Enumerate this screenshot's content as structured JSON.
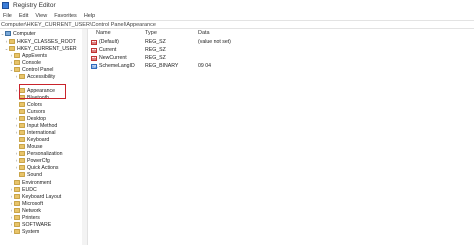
{
  "window": {
    "title": "Registry Editor"
  },
  "menu": [
    "File",
    "Edit",
    "View",
    "Favorites",
    "Help"
  ],
  "address": "Computer\\HKEY_CURRENT_USER\\Control Panel\\Appearance",
  "tree": [
    {
      "label": "Computer",
      "chevron": "⌄",
      "icon": "computer"
    },
    {
      "label": "HKEY_CLASSES_ROOT",
      "chevron": "›",
      "icon": "folder"
    },
    {
      "label": "HKEY_CURRENT_USER",
      "chevron": "⌄",
      "icon": "folder"
    },
    {
      "label": "AppEvents",
      "chevron": "›",
      "icon": "folder"
    },
    {
      "label": "Console",
      "chevron": "›",
      "icon": "folder"
    },
    {
      "label": "Control Panel",
      "chevron": "⌄",
      "icon": "folder"
    },
    {
      "label": "Accessibility",
      "chevron": "›",
      "icon": "folder"
    },
    {
      "label": "Appearance",
      "chevron": "›",
      "icon": "folder"
    },
    {
      "label": "Bluetooth",
      "chevron": "",
      "icon": "folder"
    },
    {
      "label": "Colors",
      "chevron": "",
      "icon": "folder"
    },
    {
      "label": "Cursors",
      "chevron": "",
      "icon": "folder"
    },
    {
      "label": "Desktop",
      "chevron": "›",
      "icon": "folder"
    },
    {
      "label": "Input Method",
      "chevron": "›",
      "icon": "folder"
    },
    {
      "label": "International",
      "chevron": "›",
      "icon": "folder"
    },
    {
      "label": "Keyboard",
      "chevron": "",
      "icon": "folder"
    },
    {
      "label": "Mouse",
      "chevron": "",
      "icon": "folder"
    },
    {
      "label": "Personalization",
      "chevron": "›",
      "icon": "folder"
    },
    {
      "label": "PowerCfg",
      "chevron": "›",
      "icon": "folder"
    },
    {
      "label": "Quick Actions",
      "chevron": "›",
      "icon": "folder"
    },
    {
      "label": "Sound",
      "chevron": "",
      "icon": "folder"
    },
    {
      "label": "Environment",
      "chevron": "",
      "icon": "folder"
    },
    {
      "label": "EUDC",
      "chevron": "›",
      "icon": "folder"
    },
    {
      "label": "Keyboard Layout",
      "chevron": "›",
      "icon": "folder"
    },
    {
      "label": "Microsoft",
      "chevron": "›",
      "icon": "folder"
    },
    {
      "label": "Network",
      "chevron": "›",
      "icon": "folder"
    },
    {
      "label": "Printers",
      "chevron": "›",
      "icon": "folder"
    },
    {
      "label": "SOFTWARE",
      "chevron": "›",
      "icon": "folder"
    },
    {
      "label": "System",
      "chevron": "›",
      "icon": "folder"
    }
  ],
  "columns": {
    "name": "Name",
    "type": "Type",
    "data": "Data"
  },
  "values": [
    {
      "name": "(Default)",
      "type": "REG_SZ",
      "data": "(value not set)",
      "icon": "ab"
    },
    {
      "name": "Current",
      "type": "REG_SZ",
      "data": "",
      "icon": "ab"
    },
    {
      "name": "NewCurrent",
      "type": "REG_SZ",
      "data": "",
      "icon": "ab"
    },
    {
      "name": "SchemeLangID",
      "type": "REG_BINARY",
      "data": "09 04",
      "icon": "bin"
    }
  ],
  "icons": {
    "ab": "ab",
    "bin": "011"
  },
  "colors": {
    "highlight_border": "#c9232b"
  }
}
